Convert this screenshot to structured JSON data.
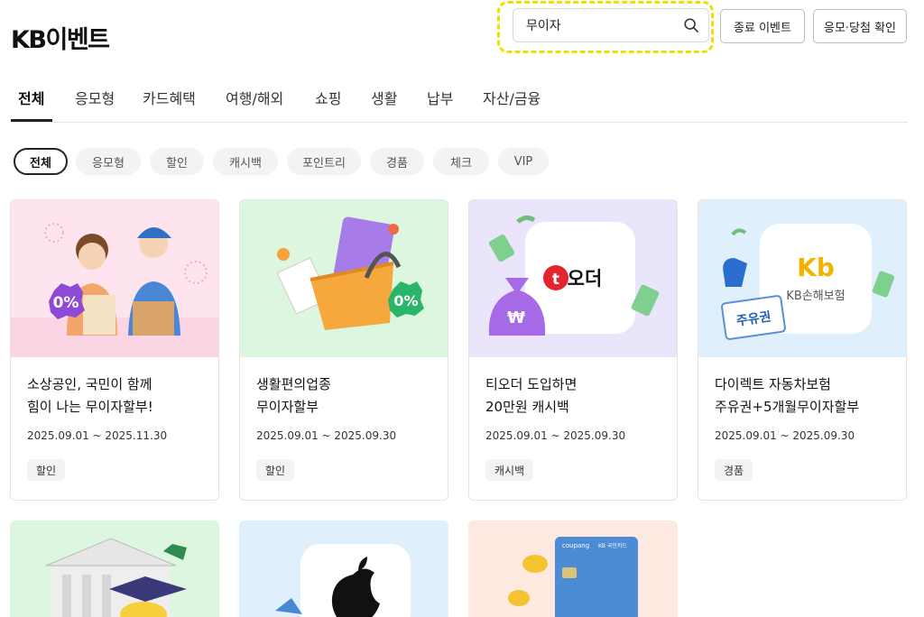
{
  "header": {
    "logo": "KB이벤트",
    "search_value": "무이자",
    "ended_events_button": "종료 이벤트",
    "check_results_button": "응모·당첨 확인"
  },
  "tabs": [
    "전체",
    "응모형",
    "카드혜택",
    "여행/해외",
    "쇼핑",
    "생활",
    "납부",
    "자산/금융"
  ],
  "chips": [
    "전체",
    "응모형",
    "할인",
    "캐시백",
    "포인트리",
    "경품",
    "체크",
    "VIP"
  ],
  "cards": [
    {
      "title": "소상공인, 국민이 함께\n힘이 나는 무이자할부!",
      "date": "2025.09.01 ~ 2025.11.30",
      "tag": "할인",
      "bg": "#fde4ee"
    },
    {
      "title": "생활편의업종\n무이자할부",
      "date": "2025.09.01 ~ 2025.09.30",
      "tag": "할인",
      "bg": "#ddf6e0"
    },
    {
      "title": "티오더 도입하면\n20만원 캐시백",
      "date": "2025.09.01 ~ 2025.09.30",
      "tag": "캐시백",
      "bg": "#ebe5fb"
    },
    {
      "title": "다이렉트 자동차보험\n주유권+5개월무이자할부",
      "date": "2025.09.01 ~ 2025.09.30",
      "tag": "경품",
      "bg": "#e0effc"
    }
  ],
  "card_images": {
    "zero_percent_badge": "0%",
    "torder_logo": "오더",
    "kb_insurance_mark": "Kb",
    "kb_insurance_name": "KB손해보험",
    "fuel_coupon": "주유권",
    "coupang_card_brand": "coupang",
    "kb_card_mark": "KB 국민카드"
  },
  "next_row_bgs": [
    "#ddf6e0",
    "#e0effc",
    "#fde9e0"
  ]
}
